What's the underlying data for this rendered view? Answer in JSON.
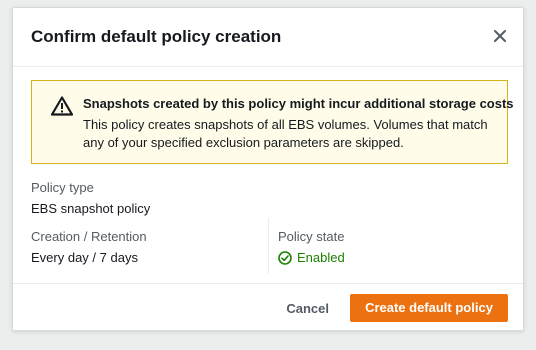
{
  "modal": {
    "title": "Confirm default policy creation",
    "close_icon": "close-icon"
  },
  "alert": {
    "icon": "warning-icon",
    "title": "Snapshots created by this policy might incur additional storage costs",
    "body": "This policy creates snapshots of all EBS volumes. Volumes that match any of your specified exclusion parameters are skipped."
  },
  "details": {
    "policy_type_label": "Policy type",
    "policy_type_value": "EBS snapshot policy",
    "creation_label": "Creation / Retention",
    "creation_value": "Every day / 7 days",
    "state_label": "Policy state",
    "state_value": "Enabled",
    "state_icon": "check-circle-icon"
  },
  "footer": {
    "cancel_label": "Cancel",
    "primary_label": "Create default policy"
  },
  "colors": {
    "primary": "#ec7211",
    "success": "#1d8102",
    "warning_border": "#d4b31f",
    "warning_bg": "#fffce9"
  }
}
